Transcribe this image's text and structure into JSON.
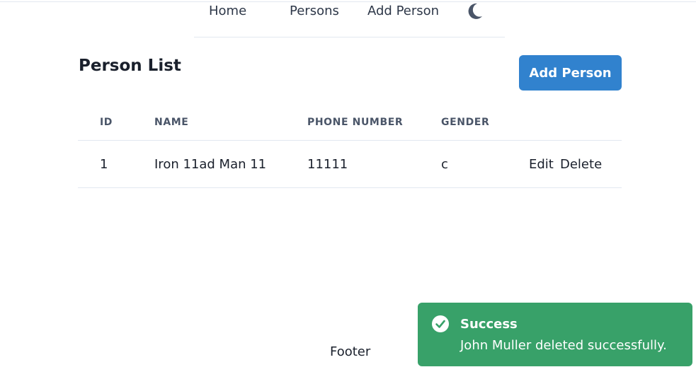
{
  "nav": {
    "home": "Home",
    "persons": "Persons",
    "add_person": "Add Person",
    "theme_icon": "moon-icon"
  },
  "page": {
    "title": "Person List",
    "add_button": "Add Person"
  },
  "table": {
    "headers": [
      "ID",
      "NAME",
      "PHONE NUMBER",
      "GENDER"
    ],
    "rows": [
      {
        "id": "1",
        "name": "Iron 11ad Man 11",
        "phone": "11111",
        "gender": "c",
        "edit": "Edit",
        "delete": "Delete"
      }
    ]
  },
  "footer": {
    "text": "Footer"
  },
  "toast": {
    "icon": "check-circle-icon",
    "title": "Success",
    "message": "John Muller deleted successfully.",
    "color": "#38a169"
  },
  "colors": {
    "accent": "#3182ce",
    "success": "#38a169"
  }
}
